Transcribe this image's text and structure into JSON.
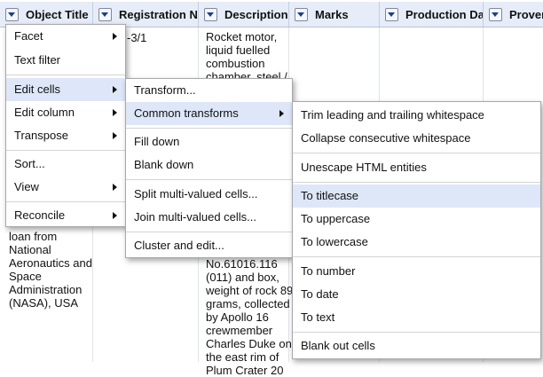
{
  "columns": [
    "Object Title",
    "Registration Nur",
    "Description.",
    "Marks",
    "Production Date",
    "Provens"
  ],
  "cells": {
    "reg_top": "-3/1",
    "desc_top": "Rocket motor,\nliquid fuelled\ncombustion\nchamber, steel /",
    "title_bottom": "moon rock on\nloan from\nNational\nAeronautics and\nSpace\nAdministration\n(NASA), USA",
    "desc_bottom": "No.61016.116\n(011) and box,\nweight of rock 89\ngrams, collected\nby Apollo 16\ncrewmember\nCharles Duke on\nthe east rim of\nPlum Crater 20"
  },
  "menu1": [
    {
      "label": "Facet",
      "submenu": true
    },
    {
      "label": "Text filter",
      "submenu": false
    },
    {
      "label": "Edit cells",
      "submenu": true
    },
    {
      "label": "Edit column",
      "submenu": true
    },
    {
      "label": "Transpose",
      "submenu": true
    },
    {
      "label": "Sort...",
      "submenu": false
    },
    {
      "label": "View",
      "submenu": true
    },
    {
      "label": "Reconcile",
      "submenu": true
    }
  ],
  "menu2": [
    {
      "label": "Transform..."
    },
    {
      "label": "Common transforms"
    },
    {
      "label": "Fill down"
    },
    {
      "label": "Blank down"
    },
    {
      "label": "Split multi-valued cells..."
    },
    {
      "label": "Join multi-valued cells..."
    },
    {
      "label": "Cluster and edit..."
    }
  ],
  "menu3": [
    {
      "label": "Trim leading and trailing whitespace"
    },
    {
      "label": "Collapse consecutive whitespace"
    },
    {
      "label": "Unescape HTML entities"
    },
    {
      "label": "To titlecase"
    },
    {
      "label": "To uppercase"
    },
    {
      "label": "To lowercase"
    },
    {
      "label": "To number"
    },
    {
      "label": "To date"
    },
    {
      "label": "To text"
    },
    {
      "label": "Blank out cells"
    }
  ],
  "colors": {
    "header_bg": "#e6edf8",
    "highlight": "#dde7f8",
    "arrow_blue": "#1b3f8a"
  }
}
